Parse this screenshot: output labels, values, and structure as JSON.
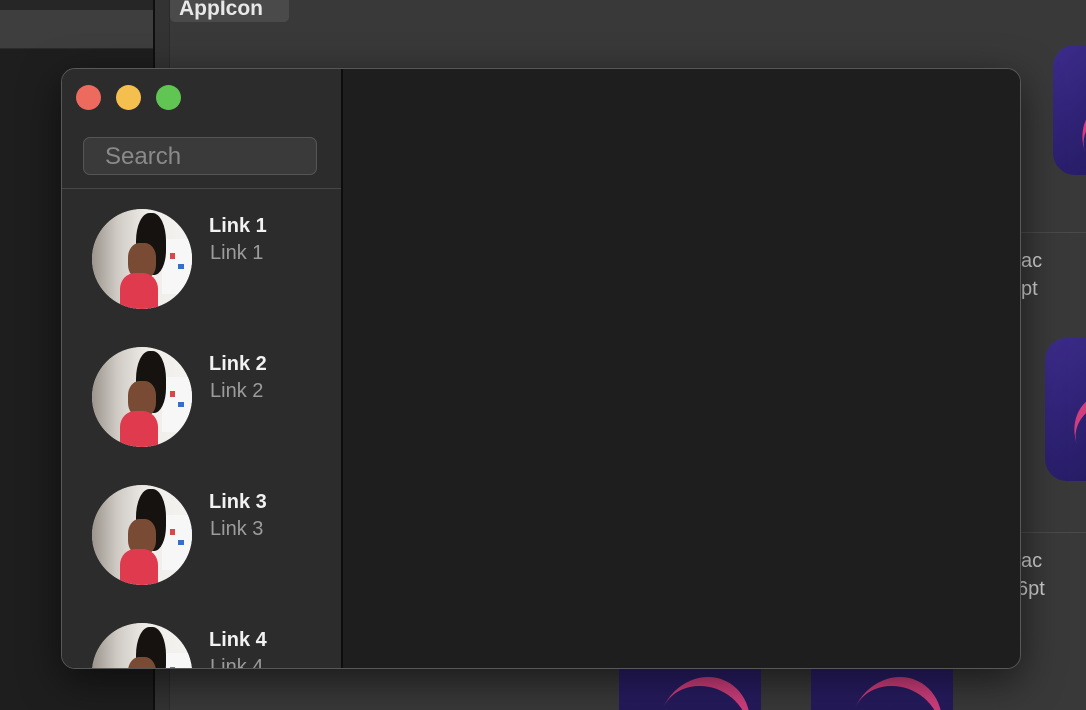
{
  "background": {
    "title_tab": "AppIcon",
    "labels": [
      {
        "line1": "ac",
        "line2": "pt"
      },
      {
        "line1": "ac",
        "line2": "6pt"
      }
    ]
  },
  "window": {
    "search": {
      "placeholder": "Search"
    },
    "links": [
      {
        "title": "Link 1",
        "subtitle": "Link 1"
      },
      {
        "title": "Link 2",
        "subtitle": "Link 2"
      },
      {
        "title": "Link 3",
        "subtitle": "Link 3"
      },
      {
        "title": "Link 4",
        "subtitle": "Link 4"
      }
    ]
  },
  "colors": {
    "close": "#ed6a5e",
    "minimize": "#f5bf4f",
    "zoom": "#61c554",
    "icon_accent": "#d13e7d"
  }
}
